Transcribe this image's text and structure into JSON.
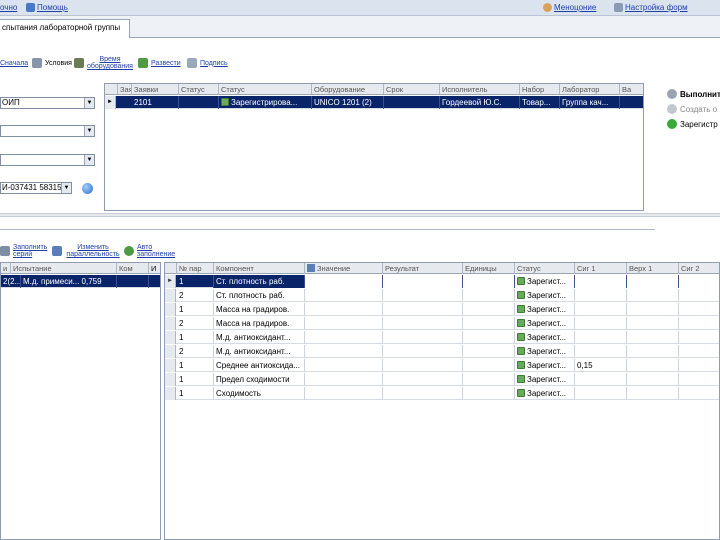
{
  "topbar": {
    "left_items": [
      {
        "label": "очно",
        "icon": "window-icon"
      },
      {
        "label": "Помощь",
        "icon": "help-icon"
      }
    ],
    "right_items": [
      {
        "label": "Меноцоние",
        "icon": "user-icon"
      },
      {
        "label": "Настройка форм",
        "icon": "settings-icon"
      }
    ]
  },
  "tab": {
    "label": "спытания лабораторной группы"
  },
  "toolbar1": {
    "items": [
      {
        "label": "Сначала",
        "icon": "arrow-icon"
      },
      {
        "label": "Условия",
        "icon": "conditions-icon"
      },
      {
        "label": "Время оборудования",
        "icon": "flask-icon"
      },
      {
        "label": "Развести",
        "icon": "person-icon"
      },
      {
        "label": "Подпись",
        "icon": "sign-icon"
      }
    ]
  },
  "filters": {
    "combo1": "ОИП",
    "combo2": "",
    "combo3": "",
    "combo4": "И-037431 58315",
    "refresh_icon": "refresh-icon"
  },
  "top_grid": {
    "columns": [
      "",
      "Заявки",
      "Статус",
      "Статус",
      "Оборудование",
      "Срок",
      "Исполнитель",
      "Набор",
      "Лаборатор",
      "Ва"
    ],
    "rows": [
      {
        "c1": "2101",
        "c2": "",
        "c3": "Зарегистрирова...",
        "c4": "UNICO 1201 (2)",
        "c5": "",
        "c6": "Гордеевой Ю.С.",
        "c7": "Товар...",
        "c8": "Группа кач...",
        "c9": ""
      }
    ]
  },
  "right_panel": {
    "items": [
      {
        "label": "Выполнить",
        "icon": "run-icon"
      },
      {
        "label": "Создать о",
        "icon": "create-icon"
      },
      {
        "label": "Зарегистр",
        "icon": "register-icon"
      }
    ]
  },
  "toolbar2": {
    "items": [
      {
        "label": "Заполнить серий",
        "icon": "fill-icon"
      },
      {
        "label": "Изменить параллельность",
        "icon": "edit-icon"
      },
      {
        "label": "Авто заполнение",
        "icon": "auto-icon"
      }
    ]
  },
  "left_grid": {
    "columns": [
      "и",
      "Испытание",
      "Ком",
      "И"
    ],
    "rows": [
      {
        "c0": "2(2...",
        "c1": "М.д. примеси... 0,759",
        "c2": "",
        "c3": ""
      }
    ]
  },
  "main_grid": {
    "columns": [
      "",
      "№ пар",
      "Компонент",
      "Значение",
      "Результат",
      "Единицы",
      "Статус",
      "Сиг 1",
      "Верх 1",
      "Сиг 2"
    ],
    "rows": [
      {
        "n": "1",
        "comp": "Ст. плотность раб.",
        "val": "",
        "res": "",
        "unit": "",
        "status": "Зарегист...",
        "s1": "",
        "v1": "",
        "s2": ""
      },
      {
        "n": "2",
        "comp": "Ст. плотность раб.",
        "val": "",
        "res": "",
        "unit": "",
        "status": "Зарегист...",
        "s1": "",
        "v1": "",
        "s2": ""
      },
      {
        "n": "1",
        "comp": "Масса на градиров.",
        "val": "",
        "res": "",
        "unit": "",
        "status": "Зарегист...",
        "s1": "",
        "v1": "",
        "s2": ""
      },
      {
        "n": "2",
        "comp": "Масса на градиров.",
        "val": "",
        "res": "",
        "unit": "",
        "status": "Зарегист...",
        "s1": "",
        "v1": "",
        "s2": ""
      },
      {
        "n": "1",
        "comp": "М.д. антиоксидант...",
        "val": "",
        "res": "",
        "unit": "",
        "status": "Зарегист...",
        "s1": "",
        "v1": "",
        "s2": ""
      },
      {
        "n": "2",
        "comp": "М.д. антиоксидант...",
        "val": "",
        "res": "",
        "unit": "",
        "status": "Зарегист...",
        "s1": "",
        "v1": "",
        "s2": ""
      },
      {
        "n": "1",
        "comp": "Среднее антиоксида...",
        "val": "",
        "res": "",
        "unit": "",
        "status": "Зарегист...",
        "s1": "0,15",
        "v1": "",
        "s2": ""
      },
      {
        "n": "1",
        "comp": "Предел сходимости",
        "val": "",
        "res": "",
        "unit": "",
        "status": "Зарегист...",
        "s1": "",
        "v1": "",
        "s2": ""
      },
      {
        "n": "1",
        "comp": "Сходимость",
        "val": "",
        "res": "",
        "unit": "",
        "status": "Зарегист...",
        "s1": "",
        "v1": "",
        "s2": ""
      }
    ]
  }
}
